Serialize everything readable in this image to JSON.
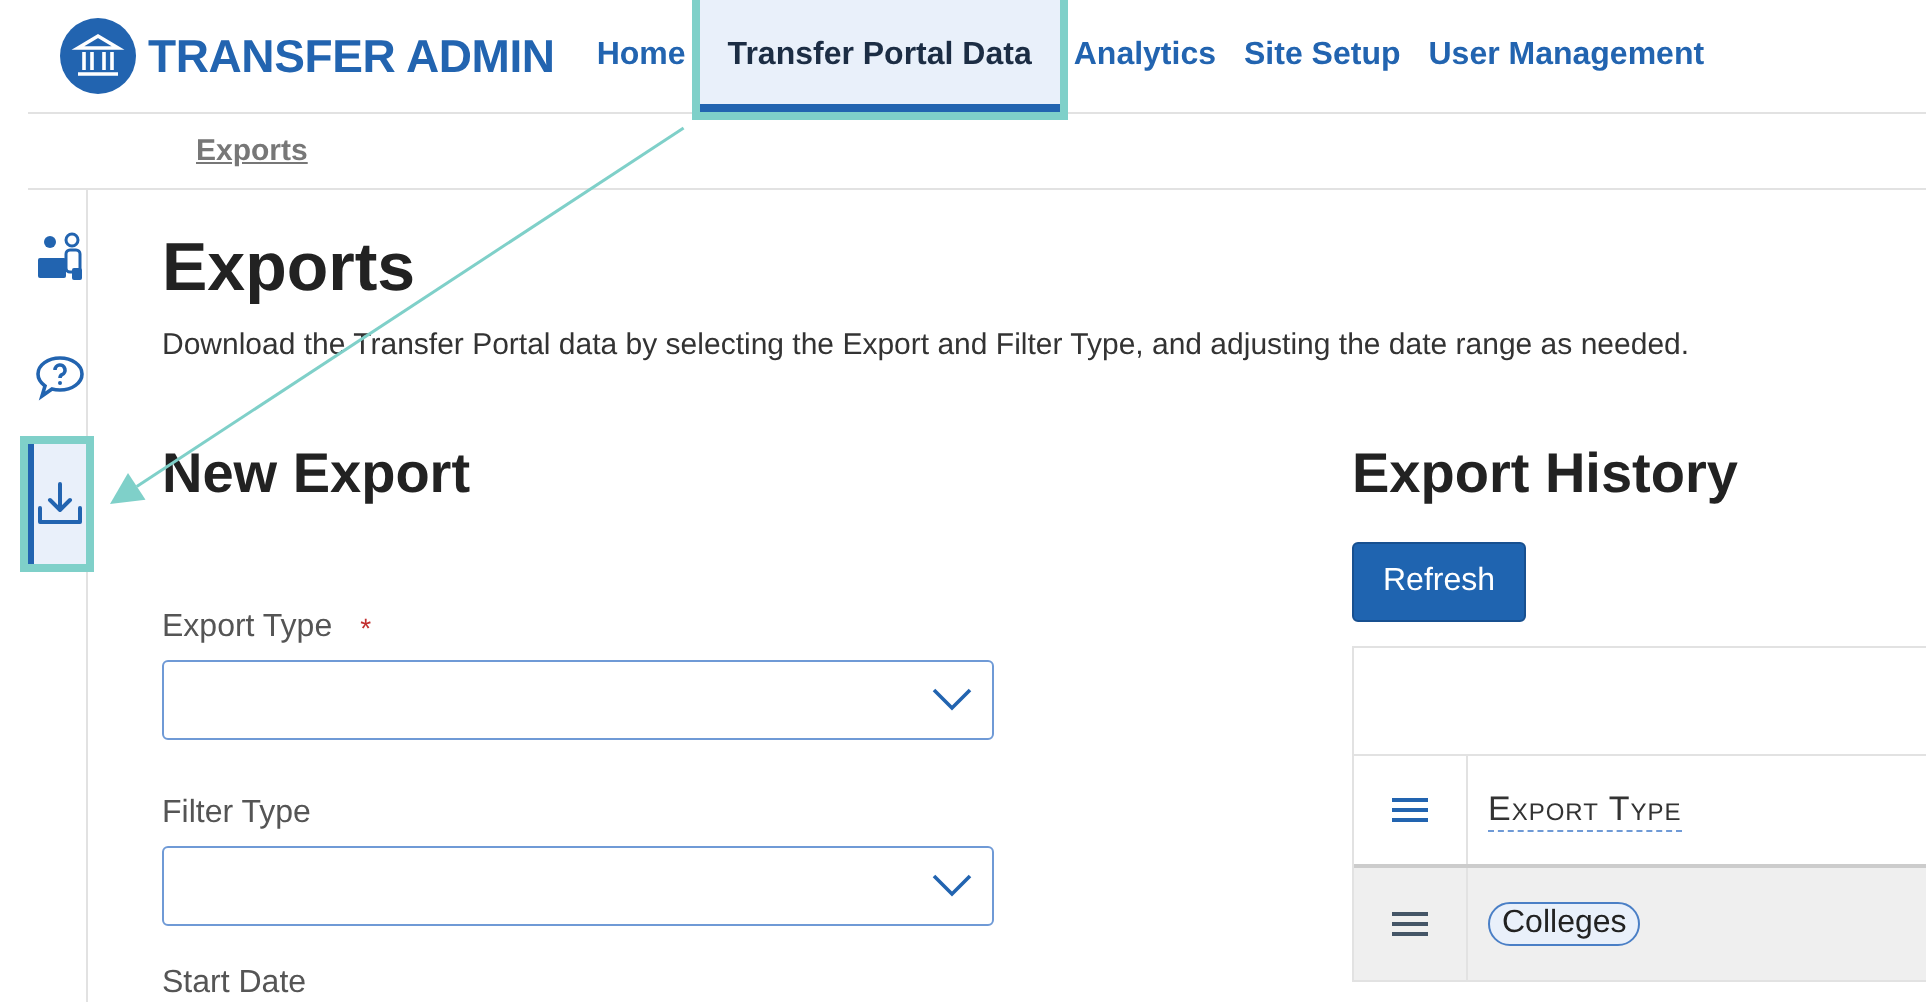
{
  "header": {
    "brand": "TRANSFER ADMIN",
    "nav": [
      {
        "label": "Home",
        "selected": false,
        "highlighted": false
      },
      {
        "label": "Transfer Portal Data",
        "selected": true,
        "highlighted": true
      },
      {
        "label": "Analytics",
        "selected": false,
        "highlighted": false
      },
      {
        "label": "Site Setup",
        "selected": false,
        "highlighted": false
      },
      {
        "label": "User Management",
        "selected": false,
        "highlighted": false
      }
    ]
  },
  "subnav": [
    {
      "label": "Exports"
    }
  ],
  "sidebar": {
    "items": [
      {
        "kind": "people",
        "selected": false,
        "highlighted": false
      },
      {
        "kind": "help",
        "selected": false,
        "highlighted": false
      },
      {
        "kind": "download",
        "selected": true,
        "highlighted": true
      }
    ]
  },
  "page": {
    "title": "Exports",
    "description": "Download the Transfer Portal data by selecting the Export and Filter Type, and adjusting the date range as needed."
  },
  "new_export": {
    "title": "New Export",
    "fields": [
      {
        "kind": "select",
        "label": "Export Type",
        "required_mark": "*"
      },
      {
        "kind": "select",
        "label": "Filter Type"
      },
      {
        "kind": "label",
        "label": "Start Date"
      }
    ]
  },
  "export_history": {
    "title": "Export History",
    "refresh": "Refresh",
    "table": {
      "columns": [
        {
          "label": "Export Type"
        }
      ],
      "rows": [
        {
          "cells": [
            "Colleges"
          ]
        }
      ]
    }
  }
}
